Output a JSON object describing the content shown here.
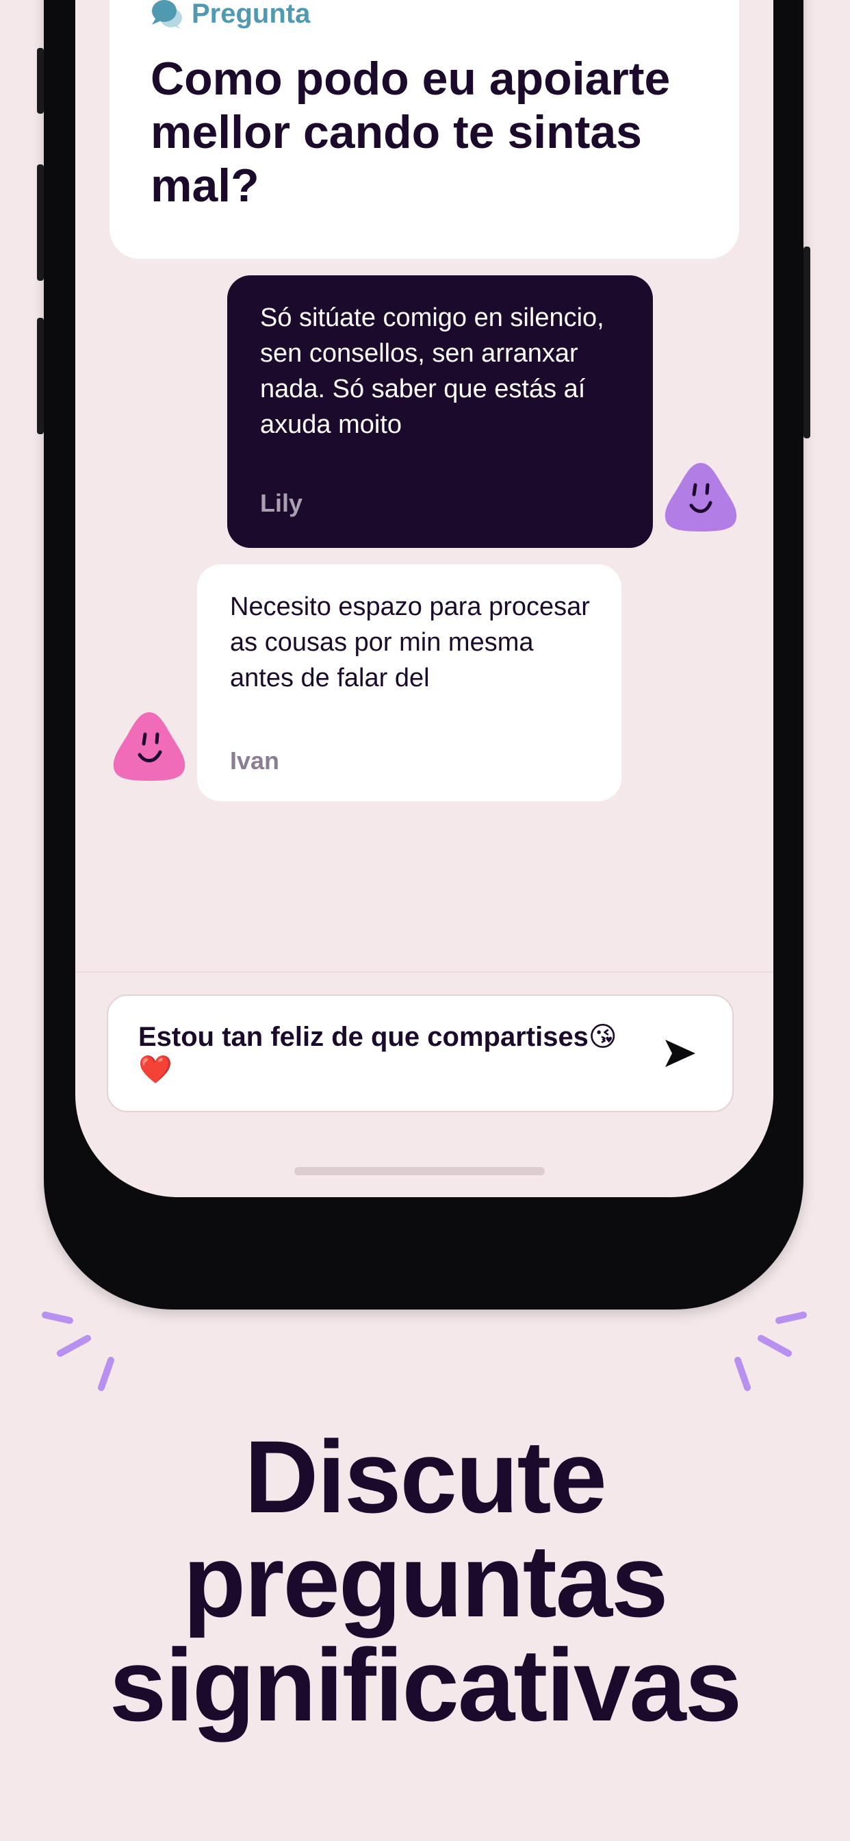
{
  "question": {
    "label": "Pregunta",
    "text": "Como podo eu apoiarte mellor cando te sintas mal?",
    "icon": "speech-bubbles-icon",
    "accent_color": "#4f9ab1"
  },
  "messages": [
    {
      "text": "Só sitúate comigo en silencio, sen consellos, sen arranxar nada. Só saber que estás aí axuda moito",
      "author": "Lily",
      "avatar_color": "#b37de6",
      "bubble_color": "#1c0a2c"
    },
    {
      "text": "Necesito espazo para procesar as cousas por min mesma antes de falar del",
      "author": "Ivan",
      "avatar_color": "#f06cb8",
      "bubble_color": "#ffffff"
    }
  ],
  "composer": {
    "value": "Estou tan feliz de que compartises😘❤️",
    "send_icon": "send-icon"
  },
  "headline": {
    "lines": [
      "Discute",
      "preguntas",
      "significativas"
    ]
  },
  "colors": {
    "background": "#f4e8ea",
    "ink": "#1c0a2c",
    "sparkle": "#b890f0"
  }
}
